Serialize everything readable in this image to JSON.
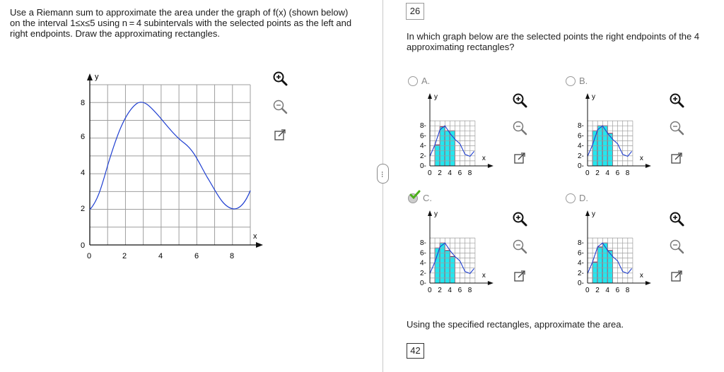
{
  "left": {
    "prompt": "Use a Riemann sum to approximate the area under the graph of f(x) (shown below) on the interval 1≤x≤5 using n = 4 subintervals with the selected points as the left and right endpoints. Draw the approximating rectangles.",
    "graph": {
      "y_axis_label": "y",
      "x_axis_label": "x",
      "y_ticks": [
        "0",
        "2",
        "4",
        "6",
        "8"
      ],
      "x_ticks": [
        "0",
        "2",
        "4",
        "6",
        "8"
      ]
    }
  },
  "right": {
    "question_number": "26",
    "question": "In which graph below are the selected points the right endpoints of the 4 approximating rectangles?",
    "options": [
      {
        "label": "A.",
        "selected": false
      },
      {
        "label": "B.",
        "selected": false
      },
      {
        "label": "C.",
        "selected": true
      },
      {
        "label": "D.",
        "selected": false
      }
    ],
    "mini_graph": {
      "y_axis_label": "y",
      "x_axis_label": "x",
      "y_ticks": [
        "0",
        "2",
        "4",
        "6",
        "8"
      ],
      "x_ticks": [
        "0",
        "2",
        "4",
        "6",
        "8"
      ]
    },
    "area_question": "Using the specified rectangles, approximate the area.",
    "area_answer": "42"
  },
  "icons": [
    "zoom-in-icon",
    "zoom-out-icon",
    "popout-icon"
  ],
  "colors": {
    "curve": "#1f3fd1",
    "rect_fill": "#25e6ee",
    "rect_stroke": "#8b1a4a",
    "check": "#4caf1a",
    "grid": "#9e9e9e"
  }
}
